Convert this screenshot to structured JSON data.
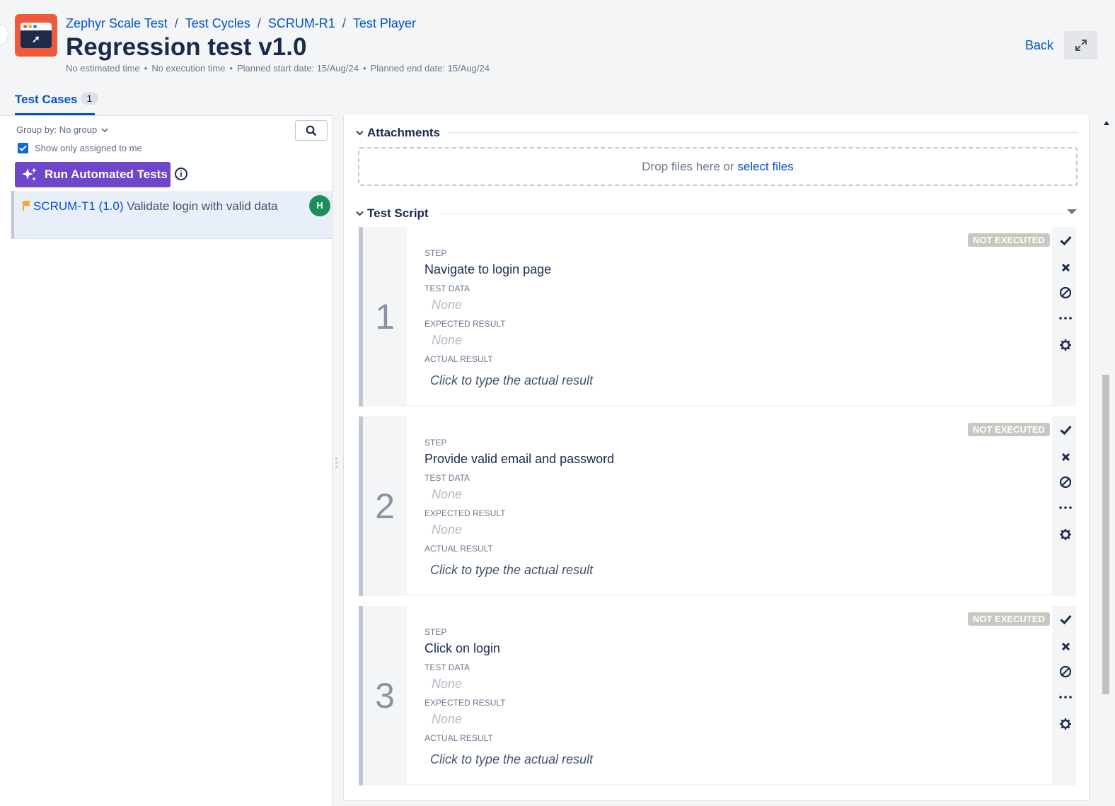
{
  "header": {
    "breadcrumb": [
      "Zephyr Scale Test",
      "Test Cycles",
      "SCRUM-R1",
      "Test Player"
    ],
    "title": "Regression test v1.0",
    "meta": {
      "estimated": "No estimated time",
      "execution": "No execution time",
      "planned_start": "Planned start date: 15/Aug/24",
      "planned_end": "Planned end date: 15/Aug/24"
    },
    "back_label": "Back"
  },
  "tabs": {
    "test_cases_label": "Test Cases",
    "test_cases_count": "1"
  },
  "sidebar": {
    "group_by": "Group by: No group",
    "show_assigned_label": "Show only assigned to me",
    "show_assigned_checked": true,
    "run_button_label": "Run Automated Tests",
    "info_glyph": "i",
    "cases": [
      {
        "key": "SCRUM-T1 (1.0)",
        "title": "Validate login with valid data",
        "assignee_initial": "H"
      }
    ]
  },
  "main": {
    "attachments": {
      "title": "Attachments",
      "drop_text": "Drop files here or",
      "select_link": "select files"
    },
    "test_script": {
      "title": "Test Script",
      "labels": {
        "step": "STEP",
        "test_data": "TEST DATA",
        "expected": "EXPECTED RESULT",
        "actual": "ACTUAL RESULT"
      },
      "steps": [
        {
          "number": "1",
          "status": "NOT EXECUTED",
          "step": "Navigate to login page",
          "test_data": "None",
          "expected": "None",
          "actual_placeholder": "Click to type the actual result"
        },
        {
          "number": "2",
          "status": "NOT EXECUTED",
          "step": "Provide valid email and password",
          "test_data": "None",
          "expected": "None",
          "actual_placeholder": "Click to type the actual result"
        },
        {
          "number": "3",
          "status": "NOT EXECUTED",
          "step": "Click on login",
          "test_data": "None",
          "expected": "None",
          "actual_placeholder": "Click to type the actual result"
        }
      ]
    }
  },
  "icons": {
    "app_logo": "zephyr-logo-icon",
    "expand": "expand-icon",
    "search": "search-icon",
    "sparkle": "sparkle-icon",
    "info": "info-icon",
    "flag": "flag-icon",
    "pass": "check-icon",
    "fail": "x-icon",
    "blocked": "blocked-icon",
    "more": "more-icon",
    "settings": "gear-icon"
  },
  "colors": {
    "link": "#0052cc",
    "run_button": "#6e46c9",
    "app_logo": "#ef5a3c",
    "avatar": "#1d8e5a",
    "flag": "#f5a623",
    "status_badge": "#c8c8c0"
  }
}
